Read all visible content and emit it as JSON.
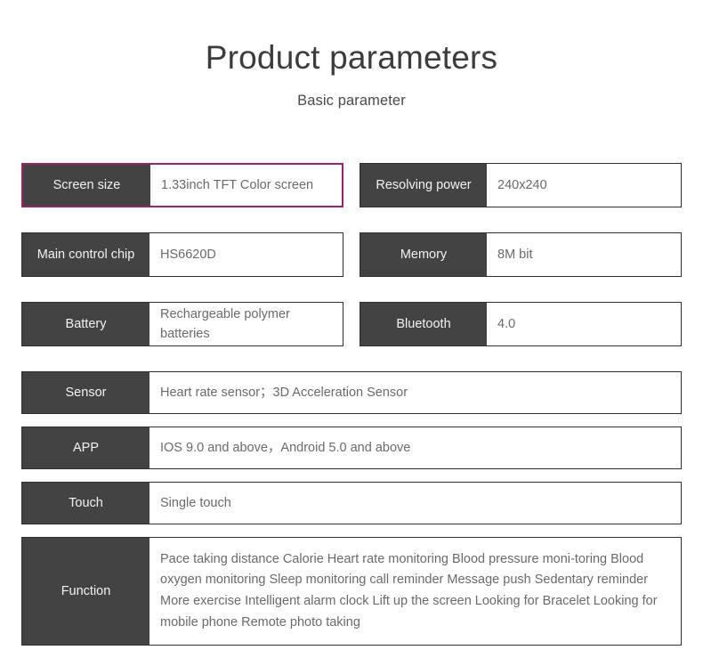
{
  "header": {
    "title": "Product parameters",
    "subtitle": "Basic parameter"
  },
  "colors": {
    "highlight_border": "#9e2168",
    "label_background": "#434343",
    "label_text": "#f2f2f2",
    "value_text": "#6a6a6a",
    "row_border": "#2f2f2f",
    "page_background": "#ffffff"
  },
  "spec_rows": [
    {
      "label": "Screen size",
      "value": "1.33inch TFT Color screen",
      "highlighted": true
    },
    {
      "label": "Resolving power",
      "value": "240x240",
      "highlighted": false
    },
    {
      "label": "Main control chip",
      "value": "HS6620D",
      "highlighted": false
    },
    {
      "label": "Memory",
      "value": "8M bit",
      "highlighted": false
    },
    {
      "label": "Battery",
      "value": "Rechargeable polymer\nbatteries",
      "highlighted": false
    },
    {
      "label": "Bluetooth",
      "value": "4.0",
      "highlighted": false
    },
    {
      "label": "Sensor",
      "value": "Heart rate sensor；3D Acceleration Sensor",
      "highlighted": false
    },
    {
      "label": "APP",
      "value": "IOS 9.0 and above，Android 5.0 and above",
      "highlighted": false
    },
    {
      "label": "Touch",
      "value": "Single touch",
      "highlighted": false
    },
    {
      "label": "Function",
      "value": "Pace taking  distance  Calorie  Heart rate monitoring  Blood pressure moni-toring  Blood oxygen monitoring  Sleep monitoring  call reminder  Message push  Sedentary reminder  More exercise  Intelligent alarm clock Lift up the screen  Looking for Bracelet  Looking for mobile phone  Remote photo taking",
      "highlighted": false
    }
  ]
}
